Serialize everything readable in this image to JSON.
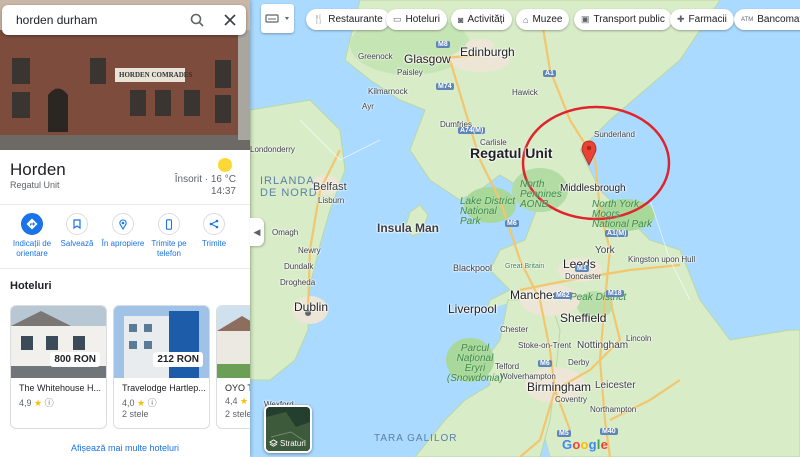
{
  "search": {
    "query": "horden durham"
  },
  "place": {
    "title": "Horden",
    "subtitle": "Regatul Unit",
    "weather": "Însorit · 16 °C",
    "time": "14:37",
    "sign_text": "HORDEN COMRADES"
  },
  "actions": [
    {
      "label_1": "Indicații de",
      "label_2": "orientare",
      "icon": "directions-icon"
    },
    {
      "label_1": "Salvează",
      "label_2": "",
      "icon": "bookmark-icon"
    },
    {
      "label_1": "În apropiere",
      "label_2": "",
      "icon": "nearby-icon"
    },
    {
      "label_1": "Trimite pe",
      "label_2": "telefon",
      "icon": "send-to-phone-icon"
    },
    {
      "label_1": "Trimite",
      "label_2": "",
      "icon": "share-icon"
    }
  ],
  "hotels": {
    "heading": "Hoteluri",
    "items": [
      {
        "name": "The Whitehouse H...",
        "price": "800 RON",
        "rating": "4,9",
        "class": ""
      },
      {
        "name": "Travelodge Hartlep...",
        "price": "212 RON",
        "rating": "4,0",
        "class": "2 stele"
      },
      {
        "name": "OYO Th...",
        "price": "",
        "rating": "4,4",
        "class": "2 stele"
      }
    ],
    "more_link": "Afișează mai multe hoteluri"
  },
  "chips": [
    {
      "label": "Restaurante",
      "icon": "fork-knife-icon"
    },
    {
      "label": "Hoteluri",
      "icon": "bed-icon"
    },
    {
      "label": "Activități",
      "icon": "camera-icon"
    },
    {
      "label": "Muzee",
      "icon": "museum-icon"
    },
    {
      "label": "Transport public",
      "icon": "train-icon"
    },
    {
      "label": "Farmacii",
      "icon": "pharmacy-icon"
    },
    {
      "label": "Bancomate",
      "icon": "atm-icon"
    }
  ],
  "layers_label": "Straturi",
  "google_logo": "Google",
  "map": {
    "country": "Regatul Unit",
    "island": "Insula Man",
    "marker_city": "Middlesbrough",
    "seas": {
      "north_ireland": "IRLANDA DE NORD",
      "wales": "TARA GALILOR"
    },
    "cities": {
      "edinburgh": "Edinburgh",
      "glasgow": "Glasgow",
      "greenock": "Greenock",
      "paisley": "Paisley",
      "kilmarnock": "Kilmarnock",
      "ayr": "Ayr",
      "hawick": "Hawick",
      "dumfries": "Dumfries",
      "carlisle": "Carlisle",
      "londonderry": "Londonderry",
      "belfast": "Belfast",
      "lisburn": "Lisburn",
      "newry": "Newry",
      "omagh": "Omagh",
      "dundalk": "Dundalk",
      "drogheda": "Drogheda",
      "dublin": "Dublin",
      "wexford": "Wexford",
      "york": "York",
      "leeds": "Leeds",
      "manchester": "Manchester",
      "liverpool": "Liverpool",
      "sheffield": "Sheffield",
      "blackpool": "Blackpool",
      "birmingham": "Birmingham",
      "nottingham": "Nottingham",
      "leicester": "Leicester",
      "kingston": "Kingston upon Hull",
      "great_britain": "Great Britain",
      "stoke": "Stoke-on-Trent",
      "chester": "Chester",
      "northampton": "Northampton",
      "coventry": "Coventry",
      "lincoln": "Lincoln",
      "doncaster": "Doncaster",
      "derby": "Derby",
      "wolverhampton": "Wolverhampton",
      "telford": "Telford",
      "sunderland": "Sunderland"
    },
    "parks": {
      "lake": "Lake District National Park",
      "npennines": "North Pennines AONB",
      "nym": "North York Moors National Park",
      "peak": "Peak District",
      "snowdonia": "Parcul Național Eryri (Snowdonia)"
    },
    "roads": [
      "M8",
      "M74",
      "A74(M)",
      "A1",
      "M6",
      "M1",
      "M62",
      "M5",
      "M40",
      "M6",
      "M18",
      "A1(M)"
    ]
  }
}
